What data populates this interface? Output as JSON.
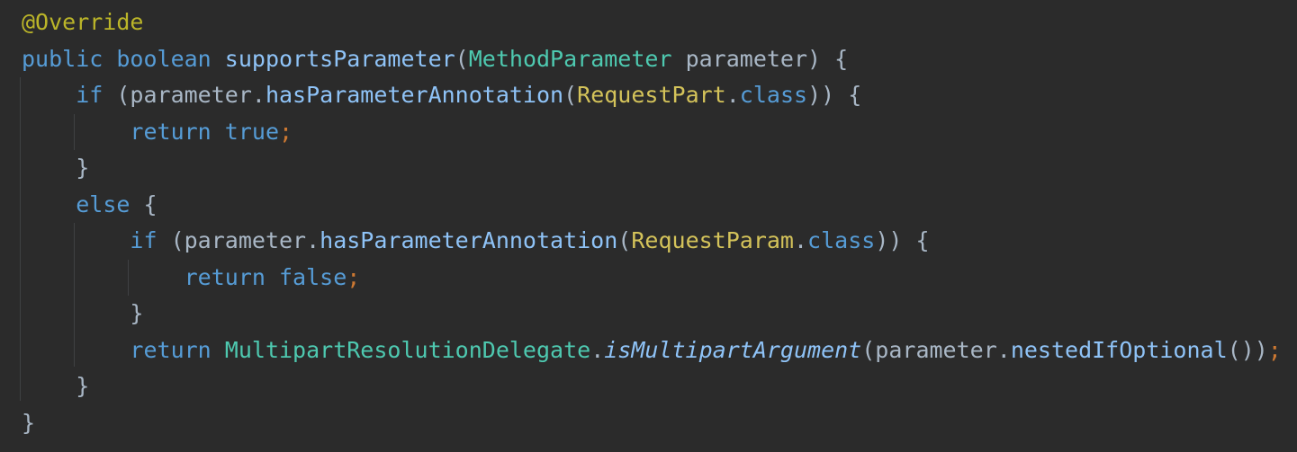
{
  "code": {
    "lines": [
      [
        {
          "t": "@Override",
          "c": "ann"
        }
      ],
      [
        {
          "t": "public",
          "c": "kw"
        },
        {
          "t": " ",
          "c": "plain"
        },
        {
          "t": "boolean",
          "c": "kw"
        },
        {
          "t": " ",
          "c": "plain"
        },
        {
          "t": "supportsParameter",
          "c": "fn"
        },
        {
          "t": "(",
          "c": "punc"
        },
        {
          "t": "MethodParameter",
          "c": "ty"
        },
        {
          "t": " parameter",
          "c": "plain"
        },
        {
          "t": ") {",
          "c": "punc"
        }
      ],
      [
        {
          "t": "    ",
          "c": "plain"
        },
        {
          "t": "if",
          "c": "kw"
        },
        {
          "t": " (parameter.",
          "c": "plain"
        },
        {
          "t": "hasParameterAnnotation",
          "c": "fn"
        },
        {
          "t": "(",
          "c": "punc"
        },
        {
          "t": "RequestPart",
          "c": "cls"
        },
        {
          "t": ".",
          "c": "punc"
        },
        {
          "t": "class",
          "c": "kw"
        },
        {
          "t": ")) {",
          "c": "punc"
        }
      ],
      [
        {
          "t": "        ",
          "c": "plain"
        },
        {
          "t": "return",
          "c": "kw"
        },
        {
          "t": " ",
          "c": "plain"
        },
        {
          "t": "true",
          "c": "kw"
        },
        {
          "t": ";",
          "c": "semi"
        }
      ],
      [
        {
          "t": "    }",
          "c": "punc"
        }
      ],
      [
        {
          "t": "    ",
          "c": "plain"
        },
        {
          "t": "else",
          "c": "kw"
        },
        {
          "t": " {",
          "c": "punc"
        }
      ],
      [
        {
          "t": "        ",
          "c": "plain"
        },
        {
          "t": "if",
          "c": "kw"
        },
        {
          "t": " (parameter.",
          "c": "plain"
        },
        {
          "t": "hasParameterAnnotation",
          "c": "fn"
        },
        {
          "t": "(",
          "c": "punc"
        },
        {
          "t": "RequestParam",
          "c": "cls"
        },
        {
          "t": ".",
          "c": "punc"
        },
        {
          "t": "class",
          "c": "kw"
        },
        {
          "t": ")) {",
          "c": "punc"
        }
      ],
      [
        {
          "t": "            ",
          "c": "plain"
        },
        {
          "t": "return",
          "c": "kw"
        },
        {
          "t": " ",
          "c": "plain"
        },
        {
          "t": "false",
          "c": "kw"
        },
        {
          "t": ";",
          "c": "semi"
        }
      ],
      [
        {
          "t": "        }",
          "c": "punc"
        }
      ],
      [
        {
          "t": "        ",
          "c": "plain"
        },
        {
          "t": "return",
          "c": "kw"
        },
        {
          "t": " ",
          "c": "plain"
        },
        {
          "t": "MultipartResolutionDelegate",
          "c": "ty"
        },
        {
          "t": ".",
          "c": "punc"
        },
        {
          "t": "isMultipartArgument",
          "c": "fn-italic"
        },
        {
          "t": "(parameter.",
          "c": "plain"
        },
        {
          "t": "nestedIfOptional",
          "c": "fn"
        },
        {
          "t": "())",
          "c": "punc"
        },
        {
          "t": ";",
          "c": "semi"
        }
      ],
      [
        {
          "t": "    }",
          "c": "punc"
        }
      ],
      [
        {
          "t": "}",
          "c": "punc"
        }
      ]
    ]
  }
}
